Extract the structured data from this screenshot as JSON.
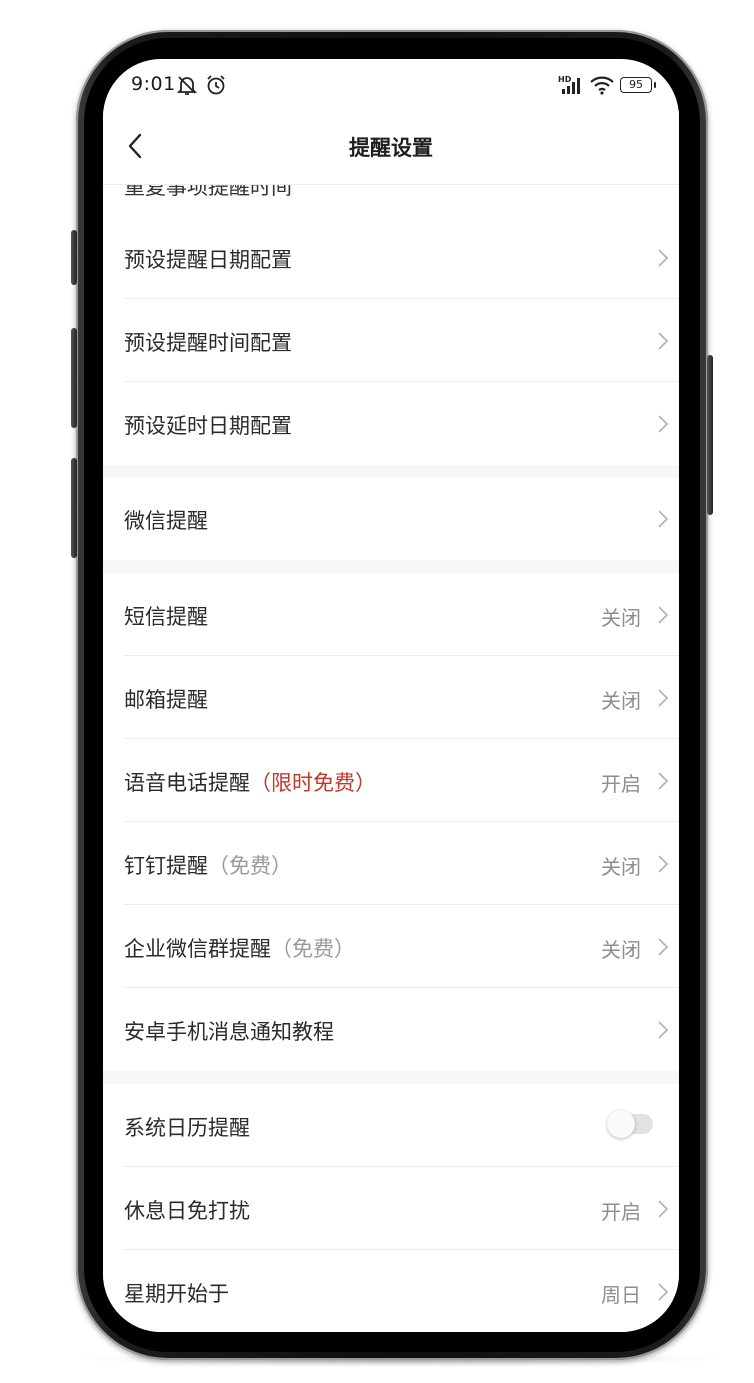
{
  "status_bar": {
    "time": "9:01",
    "battery": "95",
    "network_label": "HD"
  },
  "nav": {
    "title": "提醒设置"
  },
  "list": {
    "clipped_top_label": "重复事项提醒时间",
    "sections": [
      {
        "items": [
          {
            "label": "预设提醒日期配置",
            "value": ""
          },
          {
            "label": "预设提醒时间配置",
            "value": ""
          },
          {
            "label": "预设延时日期配置",
            "value": ""
          }
        ]
      },
      {
        "items": [
          {
            "label": "微信提醒",
            "value": ""
          }
        ]
      },
      {
        "items": [
          {
            "label": "短信提醒",
            "value": "关闭"
          },
          {
            "label": "邮箱提醒",
            "value": "关闭"
          },
          {
            "label": "语音电话提醒",
            "tag": "（限时免费）",
            "value": "开启"
          },
          {
            "label": "钉钉提醒",
            "tag": "（免费）",
            "value": "关闭"
          },
          {
            "label": "企业微信群提醒",
            "tag": "（免费）",
            "value": "关闭"
          },
          {
            "label": "安卓手机消息通知教程",
            "value": ""
          }
        ]
      },
      {
        "items": [
          {
            "label": "系统日历提醒",
            "toggle_on": false
          },
          {
            "label": "休息日免打扰",
            "value": "开启"
          },
          {
            "label": "星期开始于",
            "value": "周日"
          }
        ]
      }
    ]
  },
  "colors": {
    "accent_red": "#c0392b",
    "value_grey": "#8e8e8e",
    "divider": "#ececec",
    "section_gap": "#f7f7f7"
  },
  "icons": [
    "back-chevron-icon",
    "chevron-right-icon",
    "mute-bell-icon",
    "alarm-icon",
    "signal-icon",
    "wifi-icon",
    "battery-icon"
  ]
}
